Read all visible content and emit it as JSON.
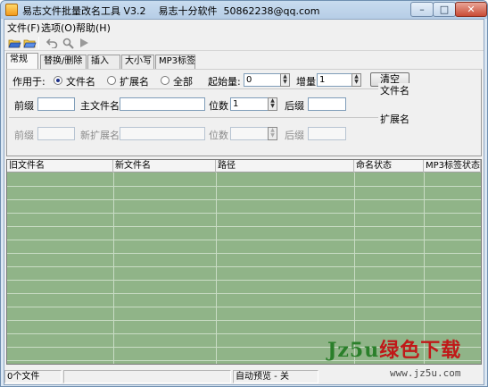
{
  "window": {
    "title": "易志文件批量改名工具 V3.2    易志十分软件  50862238@qq.com",
    "min_glyph": "–",
    "max_glyph": "□",
    "close_glyph": "✕"
  },
  "menu": [
    "文件(F)",
    "选项(O)",
    "帮助(H)"
  ],
  "toolbar": {
    "icons": [
      "open-folder-icon",
      "open-folder-alt-icon",
      "undo-icon",
      "search-icon",
      "play-icon"
    ]
  },
  "tabs": [
    {
      "label": "常规",
      "active": true
    },
    {
      "label": "替换/删除",
      "active": false
    },
    {
      "label": "插入",
      "active": false
    },
    {
      "label": "大小写",
      "active": false
    },
    {
      "label": "MP3标签",
      "active": false
    }
  ],
  "apply_to": {
    "label": "作用于:",
    "options": [
      {
        "label": "文件名",
        "selected": true
      },
      {
        "label": "扩展名",
        "selected": false
      },
      {
        "label": "全部",
        "selected": false
      }
    ]
  },
  "start": {
    "label": "起始量:",
    "value": "0"
  },
  "increment": {
    "label": "增量",
    "value": "1"
  },
  "clear_button": "清空",
  "filename_group": {
    "title": "文件名",
    "prefix_label": "前缀",
    "prefix_value": "",
    "main_label": "主文件名",
    "main_value": "",
    "digits_label": "位数",
    "digits_value": "1",
    "suffix_label": "后缀",
    "suffix_value": ""
  },
  "extension_group": {
    "title": "扩展名",
    "prefix_label": "前缀",
    "prefix_value": "",
    "main_label": "新扩展名",
    "main_value": "",
    "digits_label": "位数",
    "digits_value": "",
    "suffix_label": "后缀",
    "suffix_value": ""
  },
  "grid": {
    "columns": [
      "旧文件名",
      "新文件名",
      "路径",
      "命名状态",
      "MP3标签状态"
    ],
    "row_count": 0
  },
  "statusbar": {
    "file_count": "0个文件",
    "middle": "",
    "preview": "自动预览 - 关"
  },
  "watermark": {
    "brand_a": "Jz5u",
    "brand_b": "绿色下载",
    "url": "www.jz5u.com"
  },
  "colors": {
    "grid_bg": "#90b488",
    "accent": "#1b2f88"
  }
}
